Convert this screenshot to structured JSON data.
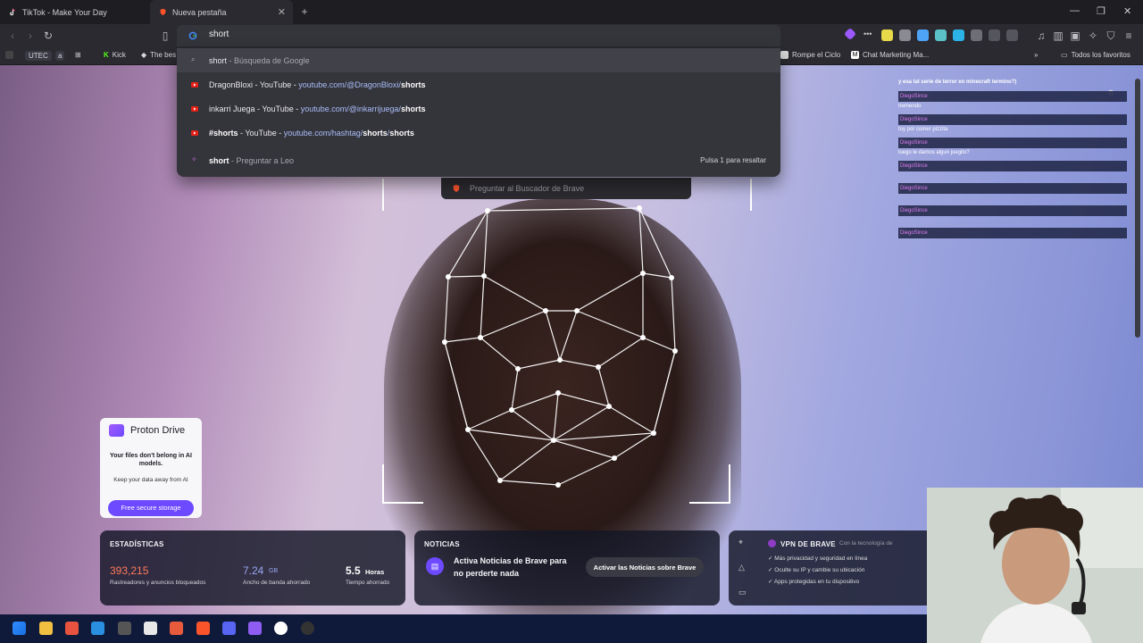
{
  "tabs": [
    {
      "title": "TikTok - Make Your Day",
      "active": false
    },
    {
      "title": "Nueva pestaña",
      "active": true
    }
  ],
  "omnibox": {
    "query": "short"
  },
  "suggestions": [
    {
      "type": "search",
      "query": "short",
      "suffix": " - Búsqueda de Google"
    },
    {
      "type": "site",
      "title": "DragonBloxi - YouTube - ",
      "url_pre": "youtube.com/@DragonBloxi/",
      "url_bold": "shorts"
    },
    {
      "type": "site",
      "title": "inkarri Juega - YouTube - ",
      "url_pre": "youtube.com/@inkarrijuega/",
      "url_bold": "shorts"
    },
    {
      "type": "site",
      "title_bold": "#shorts",
      "title": " - YouTube - ",
      "url_pre": "youtube.com/hashtag/",
      "url_bold": "shorts",
      "url_mid": "/",
      "url_bold2": "shorts"
    },
    {
      "type": "leo",
      "query": "short",
      "suffix": " - Preguntar a Leo",
      "hint": "Pulsa 1 para resaltar"
    }
  ],
  "ask_brave": "Preguntar al Buscador de Brave",
  "bookmarks": {
    "left": [
      "UTEC",
      "a",
      "Kick",
      "The bes"
    ],
    "right": [
      "Rompe el Ciclo",
      "Chat Marketing Ma...",
      "Todos los favoritos"
    ]
  },
  "chat": {
    "top_message": "y esa tal serie de terror en minecraft termino?)",
    "username": "DiegoSince",
    "messages": [
      "tremendo",
      "toy por comer pizzita",
      "luego le damos algun juegito?"
    ]
  },
  "proton": {
    "title": "Proton Drive",
    "heading": "Your files don't belong in AI models.",
    "body": "Keep your data away from AI",
    "button": "Free secure storage"
  },
  "stats": {
    "title": "ESTADÍSTICAS",
    "items": [
      {
        "value": "393,215",
        "unit": "",
        "label": "Rastreadores y anuncios bloqueados",
        "color": "#ff7a5c"
      },
      {
        "value": "7.24",
        "unit": "GB",
        "label": "Ancho de banda ahorrado",
        "color": "#9aa6f5"
      },
      {
        "value": "5.5",
        "unit": "Horas",
        "label": "Tiempo ahorrado",
        "color": "#ffffff"
      }
    ]
  },
  "news": {
    "title": "NOTICIAS",
    "text": "Activa Noticias de Brave para no perderte nada",
    "button": "Activar las Noticias sobre Brave"
  },
  "vpn": {
    "title": "VPN DE BRAVE",
    "subtitle": "Con la tecnología de",
    "features": [
      "Más privacidad y seguridad en línea",
      "Oculte su IP y cambie su ubicación",
      "Apps protegidas en tu dispositivo"
    ]
  },
  "colors": {
    "accent": "#6d4aff",
    "brave": "#fb542b",
    "highlight": "#ff7a5c"
  }
}
